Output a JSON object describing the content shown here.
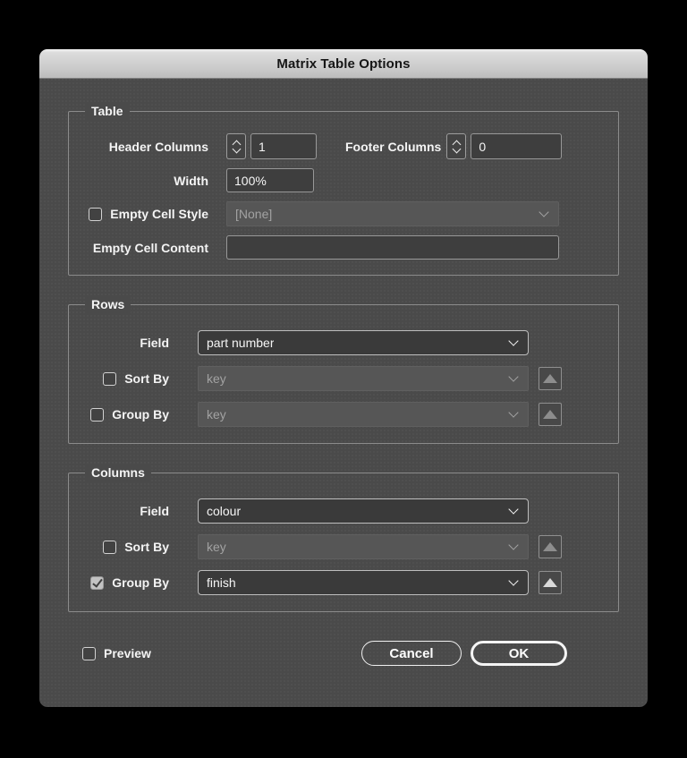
{
  "window_title": "Matrix Table Options",
  "colors": {
    "dialog_background": "#4a4a4a",
    "titlebar_gradient_top": "#f3f3f3",
    "titlebar_gradient_bottom": "#bcbcbc",
    "titlebar_text": "#161616",
    "label_text": "#f4f4f4",
    "enabled_field_border": "#bdbdbd",
    "disabled_text": "#a2a2a2",
    "field_background": "#3e3e3e"
  },
  "icons": {
    "stepper_up": "chevron-up",
    "stepper_down": "chevron-down",
    "dropdown": "chevron-down",
    "sort_direction": "triangle-up"
  },
  "table_group": {
    "legend": "Table",
    "header_columns": {
      "label": "Header Columns",
      "value": "1"
    },
    "footer_columns": {
      "label": "Footer Columns",
      "value": "0"
    },
    "width": {
      "label": "Width",
      "value": "100%"
    },
    "empty_cell_style": {
      "label": "Empty Cell Style",
      "value": "[None]",
      "checked": false
    },
    "empty_cell_content": {
      "label": "Empty Cell Content",
      "value": ""
    }
  },
  "rows_group": {
    "legend": "Rows",
    "field": {
      "label": "Field",
      "value": "part number"
    },
    "sort_by": {
      "label": "Sort By",
      "value": "key",
      "checked": false
    },
    "group_by": {
      "label": "Group By",
      "value": "key",
      "checked": false
    }
  },
  "columns_group": {
    "legend": "Columns",
    "field": {
      "label": "Field",
      "value": "colour"
    },
    "sort_by": {
      "label": "Sort By",
      "value": "key",
      "checked": false
    },
    "group_by": {
      "label": "Group By",
      "value": "finish",
      "checked": true
    }
  },
  "footer": {
    "preview": {
      "label": "Preview",
      "checked": false
    },
    "cancel_label": "Cancel",
    "ok_label": "OK"
  }
}
